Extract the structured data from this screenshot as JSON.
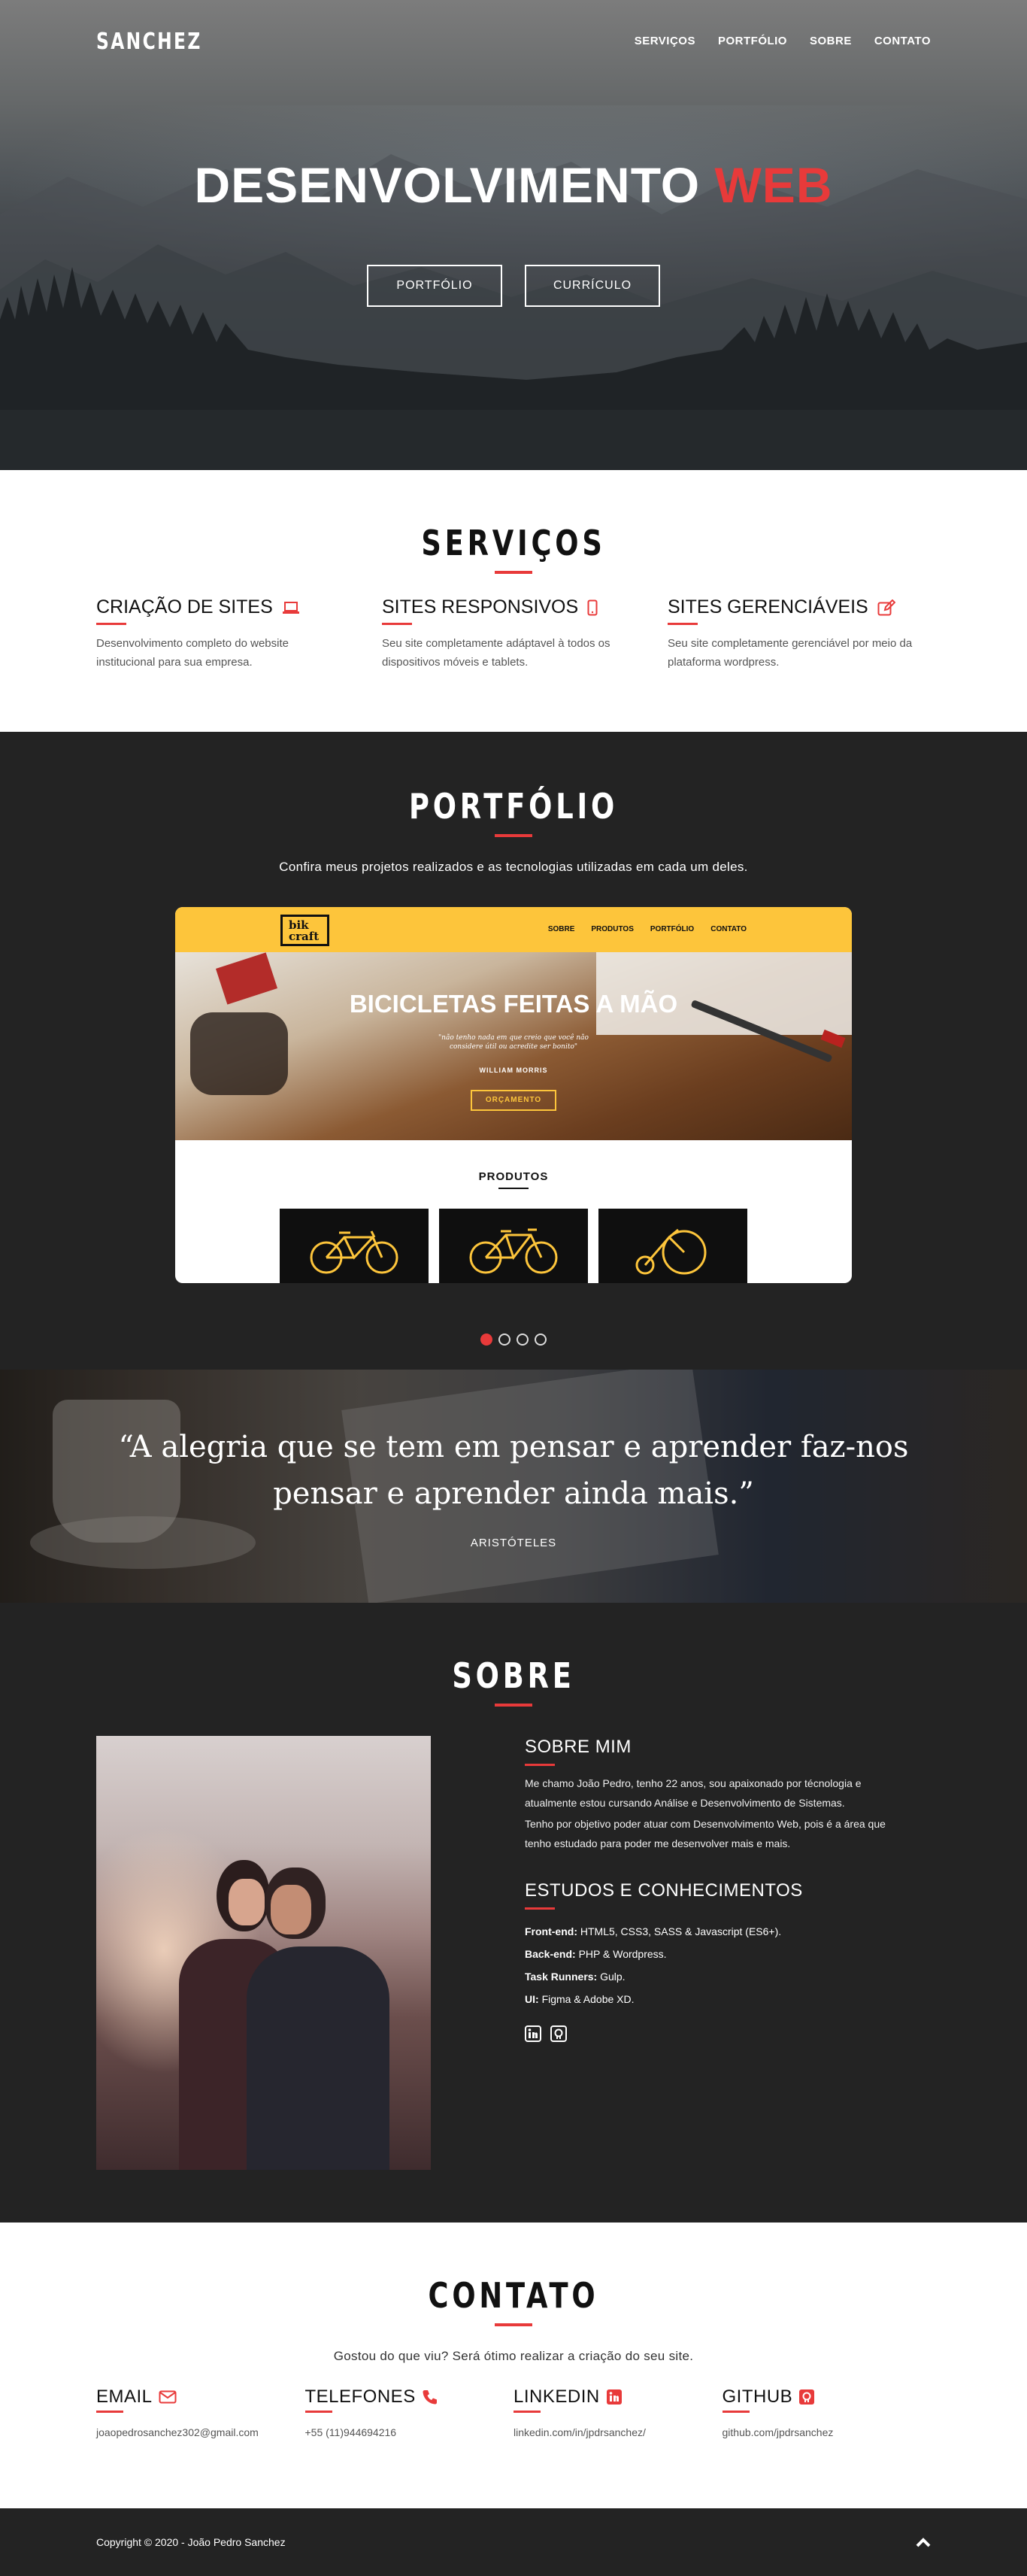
{
  "nav": {
    "logo": "SANCHEZ",
    "items": [
      "SERVIÇOS",
      "PORTFÓLIO",
      "SOBRE",
      "CONTATO"
    ]
  },
  "hero": {
    "title_main": "DESENVOLVIMENTO",
    "title_accent": "WEB",
    "buttons": [
      "PORTFÓLIO",
      "CURRÍCULO"
    ]
  },
  "services": {
    "title": "SERVIÇOS",
    "items": [
      {
        "title": "CRIAÇÃO DE SITES",
        "icon": "laptop-icon",
        "text": "Desenvolvimento completo do website institucional para sua empresa."
      },
      {
        "title": "SITES RESPONSIVOS",
        "icon": "mobile-icon",
        "text": "Seu site completamente adáptavel à todos os dispositivos móveis e tablets."
      },
      {
        "title": "SITES GERENCIÁVEIS",
        "icon": "edit-icon",
        "text": "Seu site completamente gerenciável por meio da plataforma wordpress."
      }
    ]
  },
  "portfolio": {
    "title": "PORTFÓLIO",
    "subtitle": "Confira meus projetos realizados e as tecnologias utilizadas em cada um deles.",
    "preview": {
      "logo_line1": "bik",
      "logo_line2": "craft",
      "menu": [
        "SOBRE",
        "PRODUTOS",
        "PORTFÓLIO",
        "CONTATO"
      ],
      "headline": "BICICLETAS FEITAS A MÃO",
      "quote_line1": "\"não tenho nada em que creio que você não",
      "quote_line2": "considere útil ou acredite ser bonito\"",
      "author": "WILLIAM MORRIS",
      "button": "ORÇAMENTO",
      "products_title": "PRODUTOS"
    },
    "dots": {
      "total": 4,
      "active": 1
    }
  },
  "quote": {
    "line1": "“A alegria que se tem em pensar e aprender faz-nos",
    "line2": "pensar e aprender ainda mais.”",
    "author": "ARISTÓTELES"
  },
  "about": {
    "title": "SOBRE",
    "me_title": "SOBRE MIM",
    "me_p1_l1": "Me chamo João Pedro, tenho 22 anos, sou apaixonado por técnologia e",
    "me_p1_l2": "atualmente estou cursando Análise e Desenvolvimento de Sistemas.",
    "me_p2_l1": "Tenho por objetivo poder atuar com Desenvolvimento Web, pois é a área que",
    "me_p2_l2": "tenho estudado para poder me desenvolver mais e mais.",
    "studies_title": "ESTUDOS E CONHECIMENTOS",
    "skills": [
      {
        "label": "Front-end:",
        "value": "HTML5, CSS3, SASS & Javascript (ES6+)."
      },
      {
        "label": "Back-end:",
        "value": "PHP & Wordpress."
      },
      {
        "label": "Task Runners:",
        "value": "Gulp."
      },
      {
        "label": "UI:",
        "value": "Figma & Adobe XD."
      }
    ],
    "social_icons": [
      "linkedin-icon",
      "github-icon"
    ]
  },
  "contact": {
    "title": "CONTATO",
    "subtitle": "Gostou do que viu? Será ótimo realizar a criação do seu site.",
    "items": [
      {
        "title": "EMAIL",
        "icon": "envelope-icon",
        "value": "joaopedrosanchez302@gmail.com"
      },
      {
        "title": "TELEFONES",
        "icon": "phone-icon",
        "value": "+55 (11)944694216"
      },
      {
        "title": "LINKEDIN",
        "icon": "linkedin-icon",
        "value": "linkedin.com/in/jpdrsanchez/"
      },
      {
        "title": "GITHUB",
        "icon": "github-icon",
        "value": "github.com/jpdrsanchez"
      }
    ]
  },
  "footer": {
    "copyright": "Copyright © 2020 - João Pedro Sanchez"
  },
  "colors": {
    "accent": "#e83a3a",
    "dark": "#232323",
    "bikcraft_yellow": "#fdc53b"
  }
}
